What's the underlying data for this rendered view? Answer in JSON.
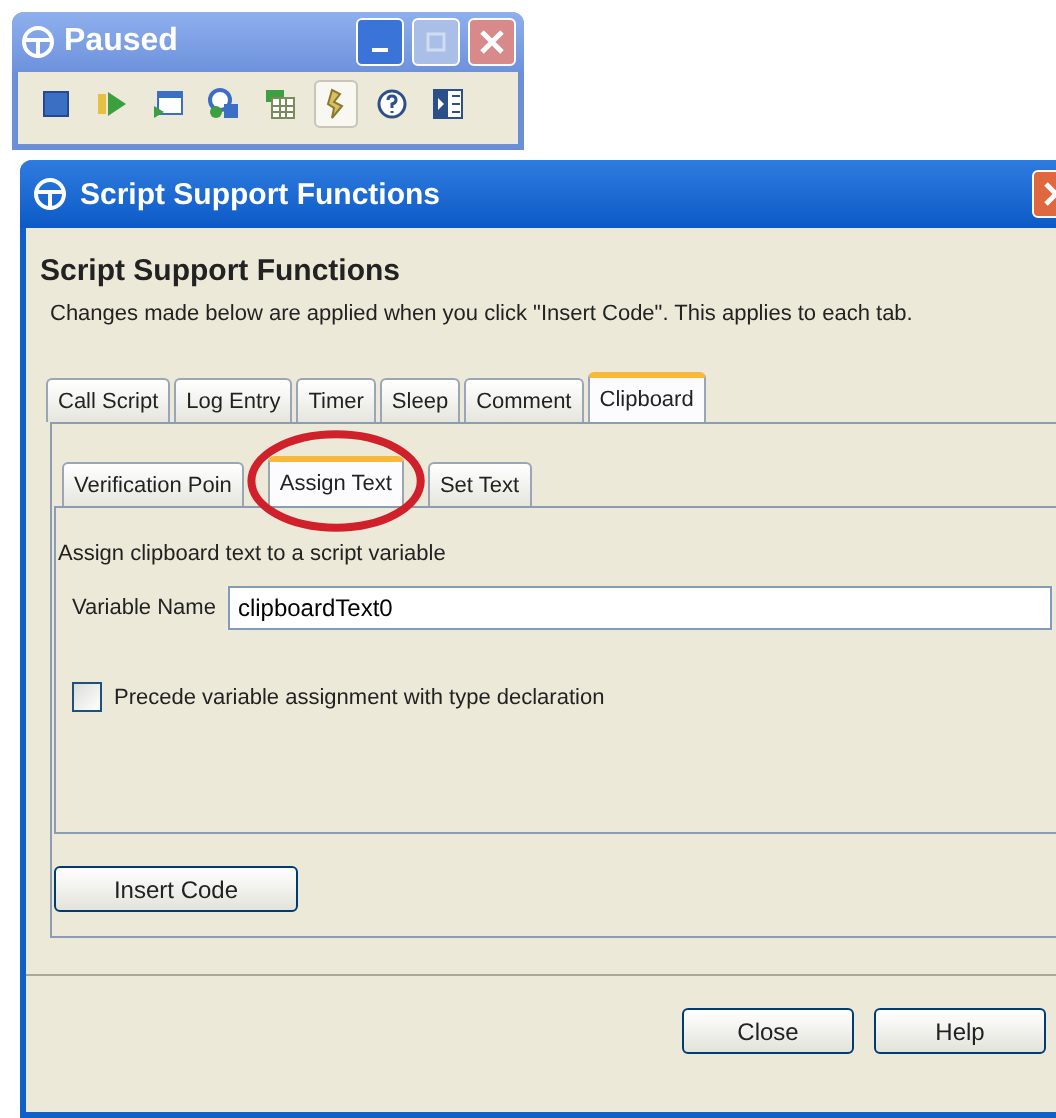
{
  "player_window": {
    "title": "Paused",
    "tools": [
      {
        "kind": "stop",
        "pressed": false
      },
      {
        "kind": "play",
        "pressed": false
      },
      {
        "kind": "window",
        "pressed": false
      },
      {
        "kind": "record",
        "pressed": false
      },
      {
        "kind": "table",
        "pressed": false
      },
      {
        "kind": "hand",
        "pressed": true
      },
      {
        "kind": "help",
        "pressed": false
      },
      {
        "kind": "panel",
        "pressed": false
      }
    ]
  },
  "dialog": {
    "title": "Script Support Functions",
    "heading": "Script Support Functions",
    "description": "Changes made below are applied when you click \"Insert Code\". This applies to each tab.",
    "tabs": [
      {
        "label": "Call Script",
        "selected": false
      },
      {
        "label": "Log Entry",
        "selected": false
      },
      {
        "label": "Timer",
        "selected": false
      },
      {
        "label": "Sleep",
        "selected": false
      },
      {
        "label": "Comment",
        "selected": false
      },
      {
        "label": "Clipboard",
        "selected": true
      }
    ],
    "subtabs": [
      {
        "label": "Verification Poin",
        "selected": false
      },
      {
        "label": "Assign Text",
        "selected": true
      },
      {
        "label": "Set Text",
        "selected": false
      }
    ],
    "panel_caption": "Assign clipboard text to a script variable",
    "variable_label": "Variable Name",
    "variable_value": "clipboardText0",
    "checkbox": {
      "label": "Precede variable assignment with type declaration",
      "checked": false
    },
    "insert_button": "Insert Code",
    "buttons": [
      "Close",
      "Help"
    ]
  }
}
